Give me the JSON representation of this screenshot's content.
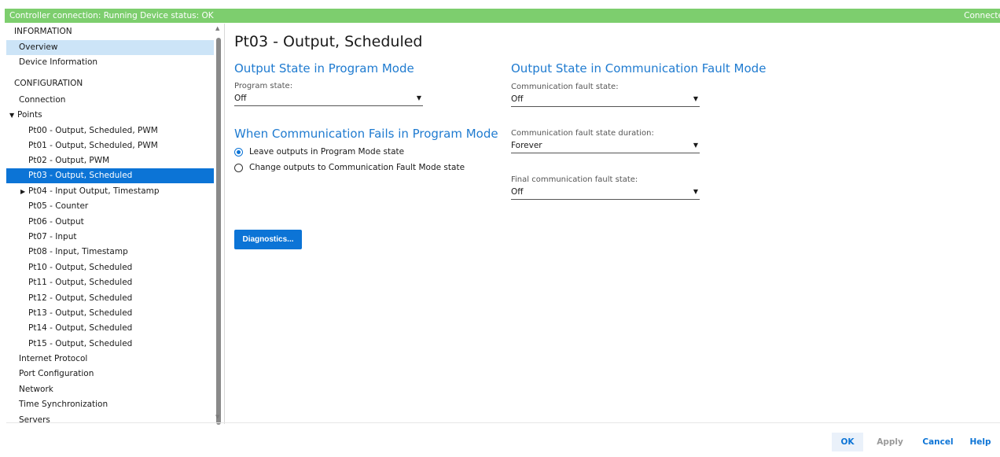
{
  "status_bar": {
    "left_text": "Controller connection: Running  Device status: OK",
    "right_text": "Connecte"
  },
  "sidebar": {
    "items": [
      {
        "label": "INFORMATION",
        "type": "header"
      },
      {
        "label": "Overview",
        "type": "item",
        "state": "highlighted"
      },
      {
        "label": "Device Information",
        "type": "item"
      },
      {
        "label": "CONFIGURATION",
        "type": "header"
      },
      {
        "label": "Connection",
        "type": "item"
      },
      {
        "label": "Points",
        "type": "group",
        "expanded": true
      },
      {
        "label": "Pt00 - Output, Scheduled, PWM",
        "type": "child"
      },
      {
        "label": "Pt01 - Output, Scheduled, PWM",
        "type": "child"
      },
      {
        "label": "Pt02 - Output, PWM",
        "type": "child"
      },
      {
        "label": "Pt03 - Output, Scheduled",
        "type": "child",
        "state": "selected"
      },
      {
        "label": "Pt04 - Input Output, Timestamp",
        "type": "child-group",
        "expanded": false
      },
      {
        "label": "Pt05 - Counter",
        "type": "child"
      },
      {
        "label": "Pt06 - Output",
        "type": "child"
      },
      {
        "label": "Pt07 - Input",
        "type": "child"
      },
      {
        "label": "Pt08 - Input, Timestamp",
        "type": "child"
      },
      {
        "label": "Pt10 - Output, Scheduled",
        "type": "child"
      },
      {
        "label": "Pt11 - Output, Scheduled",
        "type": "child"
      },
      {
        "label": "Pt12 - Output, Scheduled",
        "type": "child"
      },
      {
        "label": "Pt13 - Output, Scheduled",
        "type": "child"
      },
      {
        "label": "Pt14 - Output, Scheduled",
        "type": "child"
      },
      {
        "label": "Pt15 - Output, Scheduled",
        "type": "child"
      },
      {
        "label": "Internet Protocol",
        "type": "item"
      },
      {
        "label": "Port Configuration",
        "type": "item"
      },
      {
        "label": "Network",
        "type": "item"
      },
      {
        "label": "Time Synchronization",
        "type": "item"
      },
      {
        "label": "Servers",
        "type": "item"
      }
    ]
  },
  "main": {
    "title": "Pt03 - Output, Scheduled",
    "program_mode": {
      "title": "Output State in Program Mode",
      "program_state_label": "Program state:",
      "program_state_value": "Off"
    },
    "comm_fails": {
      "title": "When Communication Fails in Program Mode",
      "options": [
        {
          "label": "Leave outputs in Program Mode state",
          "checked": true
        },
        {
          "label": "Change outputs to Communication Fault Mode state",
          "checked": false
        }
      ]
    },
    "fault_mode": {
      "title": "Output State in Communication Fault Mode",
      "fault_state_label": "Communication fault state:",
      "fault_state_value": "Off",
      "duration_label": "Communication fault state duration:",
      "duration_value": "Forever",
      "final_label": "Final communication fault state:",
      "final_value": "Off"
    },
    "diagnostics_label": "Diagnostics..."
  },
  "footer": {
    "ok": "OK",
    "apply": "Apply",
    "cancel": "Cancel",
    "help": "Help"
  },
  "colors": {
    "status_green": "#7dce6e",
    "accent_blue": "#0c74d6",
    "section_blue": "#1f7bd0",
    "highlight_light": "#cce4f7"
  }
}
